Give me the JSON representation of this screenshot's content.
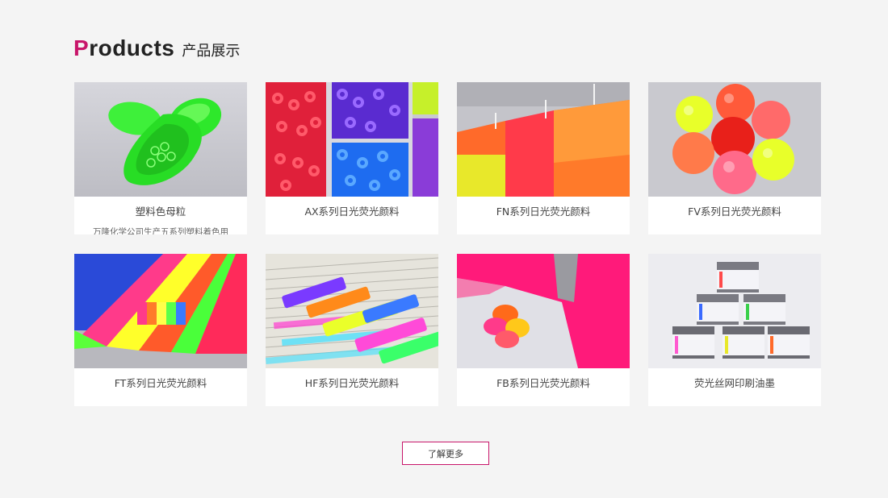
{
  "section": {
    "title_first_letter": "P",
    "title_rest": "roducts",
    "title_cn": "产品展示",
    "accent_color": "#c8156a"
  },
  "products": [
    {
      "title": "塑料色母粒",
      "desc": "万隆化学公司生产五系列塑料着色用"
    },
    {
      "title": "AX系列日光荧光颜料",
      "desc": ""
    },
    {
      "title": "FN系列日光荧光颜料",
      "desc": ""
    },
    {
      "title": "FV系列日光荧光颜料",
      "desc": ""
    },
    {
      "title": "FT系列日光荧光颜料",
      "desc": ""
    },
    {
      "title": "HF系列日光荧光颜料",
      "desc": ""
    },
    {
      "title": "FB系列日光荧光颜料",
      "desc": ""
    },
    {
      "title": "荧光丝网印刷油墨",
      "desc": ""
    }
  ],
  "more_button": {
    "label": "了解更多"
  }
}
